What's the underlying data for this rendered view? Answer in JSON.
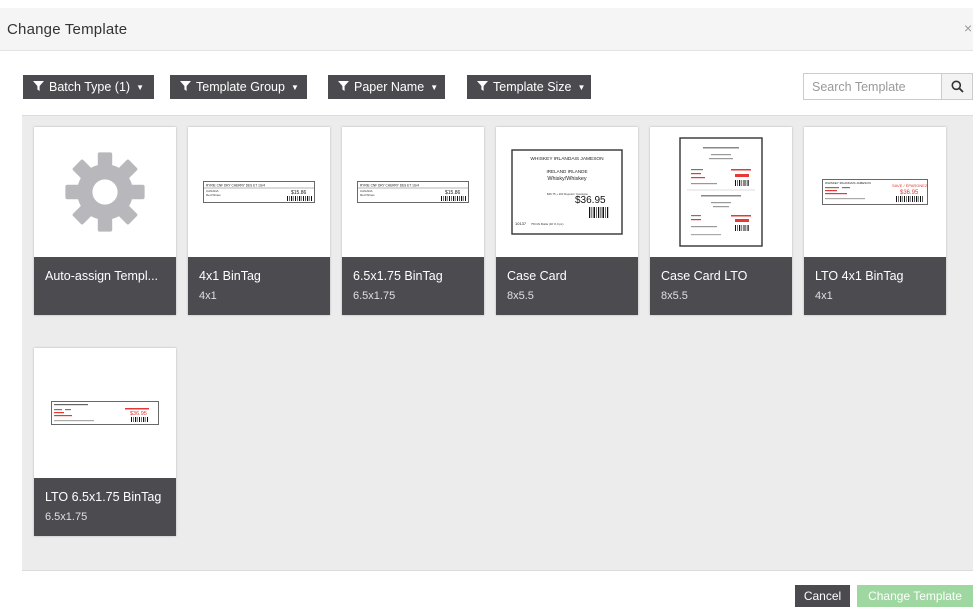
{
  "dialog": {
    "title": "Change Template",
    "close_glyph": "×"
  },
  "filters": [
    {
      "label": "Batch Type (1)",
      "icon": "filter-icon"
    },
    {
      "label": "Template Group",
      "icon": "filter-icon"
    },
    {
      "label": "Paper Name",
      "icon": "filter-icon"
    },
    {
      "label": "Template Size",
      "icon": "filter-icon"
    }
  ],
  "search": {
    "placeholder": "Search Template",
    "icon": "search-icon"
  },
  "templates": [
    {
      "name": "Auto-assign Templ...",
      "size": "",
      "thumb": "gear-icon"
    },
    {
      "name": "4x1 BinTag",
      "size": "4x1",
      "thumb": "bintag-preview"
    },
    {
      "name": "6.5x1.75 BinTag",
      "size": "6.5x1.75",
      "thumb": "bintag-preview"
    },
    {
      "name": "Case Card",
      "size": "8x5.5",
      "thumb": "case-card-preview"
    },
    {
      "name": "Case Card LTO",
      "size": "8x5.5",
      "thumb": "case-card-lto-preview"
    },
    {
      "name": "LTO 4x1 BinTag",
      "size": "4x1",
      "thumb": "lto-bintag-preview"
    },
    {
      "name": "LTO 6.5x1.75 BinTag",
      "size": "6.5x1.75",
      "thumb": "lto-bintag-preview"
    }
  ],
  "previews": {
    "bintag_line1": "RYRIE CNF DRY CHERRY DES ET 1G/4",
    "bintag_line2": "CANADA",
    "bintag_line3": "Red Wines",
    "bintag_price": "$15.86",
    "case_title": "WHISKEY IRLANDAIS JAMESON",
    "case_sub1": "IRELAND  IRLANDE",
    "case_sub2": "Whisky/Whiskey",
    "case_price": "$36.95",
    "case_deposit": "$36.75 + 20¢  Deposit / Consigne",
    "case_code": "10137",
    "case_qty": "750 ML  Bottle  (40 % 0 pL)",
    "lto_save": "SAVE / ÉPARGNEZ",
    "lto_price": "$36.95"
  },
  "footer": {
    "cancel": "Cancel",
    "change": "Change Template"
  },
  "colors": {
    "dark_button": "#4a4a4f",
    "card_caption": "#4b4b50",
    "primary_disabled": "#9fd7a0",
    "panel_bg": "#ececec",
    "lto_red": "#e53935"
  }
}
